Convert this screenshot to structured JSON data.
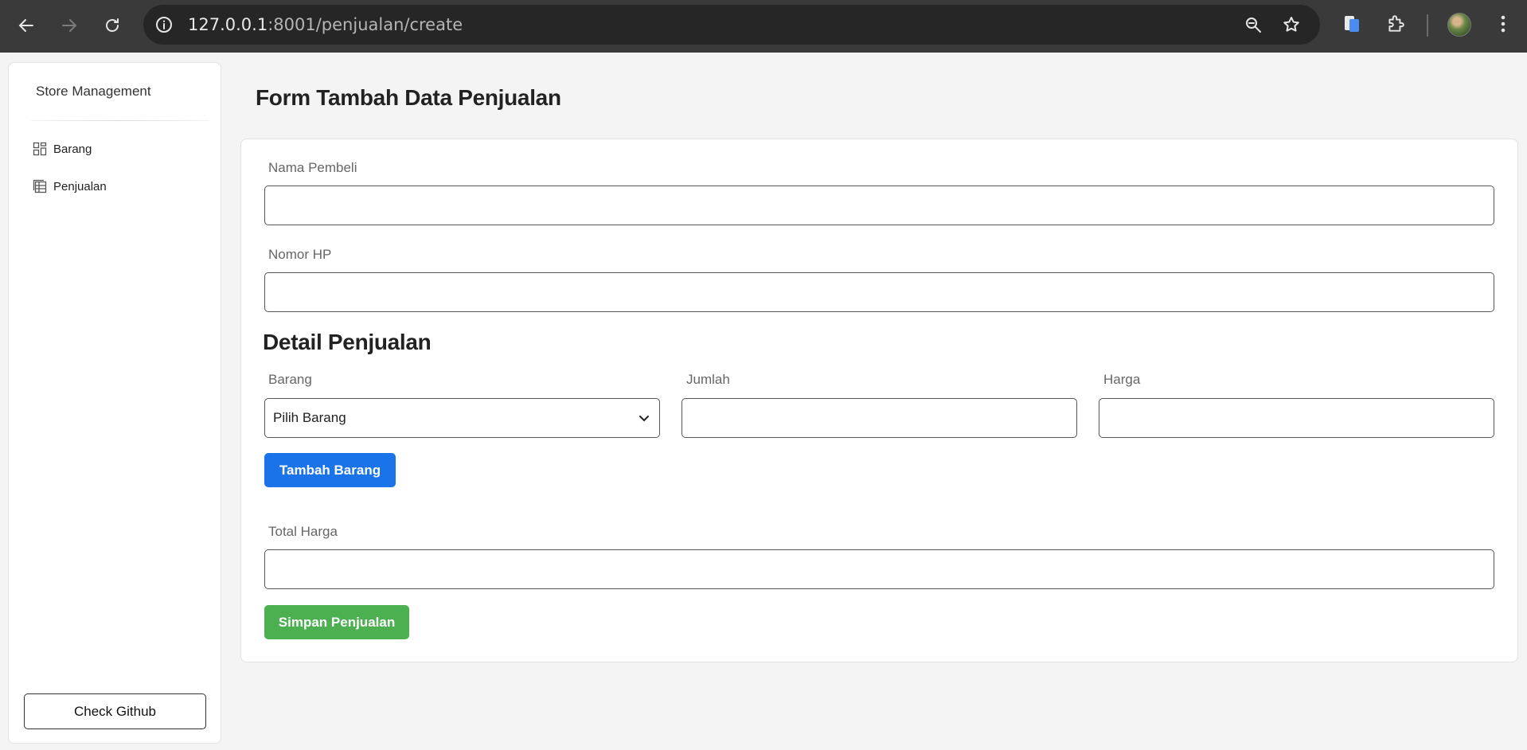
{
  "browser": {
    "url_host": "127.0.0.1",
    "url_rest": ":8001/penjualan/create"
  },
  "sidebar": {
    "brand": "Store Management",
    "items": [
      {
        "label": "Barang",
        "icon": "grid-icon"
      },
      {
        "label": "Penjualan",
        "icon": "table-icon"
      }
    ],
    "github_button": "Check Github"
  },
  "main": {
    "page_title": "Form Tambah Data Penjualan",
    "form": {
      "nama_pembeli_label": "Nama Pembeli",
      "nama_pembeli_value": "",
      "nomor_hp_label": "Nomor HP",
      "nomor_hp_value": "",
      "detail_title": "Detail Penjualan",
      "barang_label": "Barang",
      "barang_selected": "Pilih Barang",
      "jumlah_label": "Jumlah",
      "jumlah_value": "",
      "harga_label": "Harga",
      "harga_value": "",
      "tambah_barang_button": "Tambah Barang",
      "total_harga_label": "Total Harga",
      "total_harga_value": "",
      "simpan_button": "Simpan Penjualan"
    }
  },
  "colors": {
    "primary_blue": "#1a73e8",
    "success_green": "#4caf50",
    "browser_bar": "#3a3a3a"
  }
}
